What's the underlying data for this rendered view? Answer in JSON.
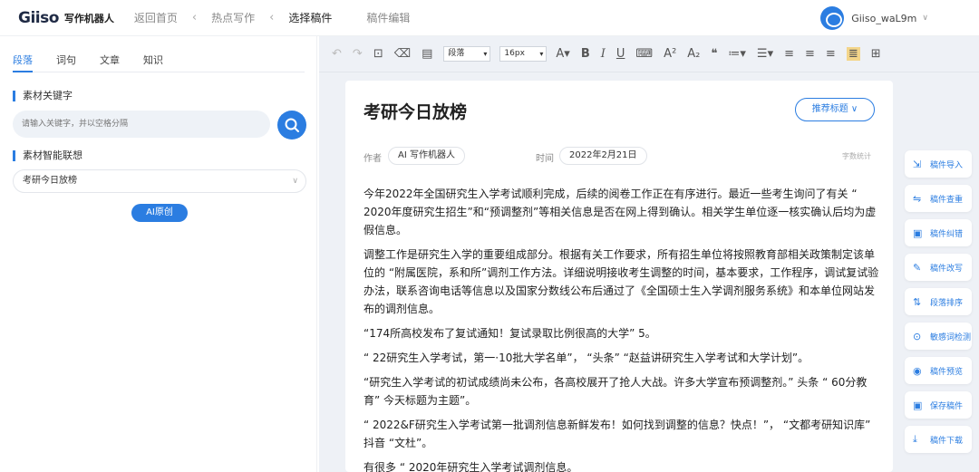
{
  "header": {
    "logo": "Giiso",
    "app_name": "写作机器人",
    "breadcrumbs": [
      "返回首页",
      "热点写作",
      "选择稿件"
    ],
    "extra": "稿件编辑",
    "user": "Giiso_waL9m"
  },
  "left": {
    "tabs": [
      "段落",
      "词句",
      "文章",
      "知识"
    ],
    "keyword_title": "素材关键字",
    "search_placeholder": "请输入关键字，并以空格分隔",
    "assoc_title": "素材智能联想",
    "assoc_value": "考研今日放榜",
    "ai_button": "AI原创"
  },
  "toolbar": {
    "paragraph_select": "段落",
    "font_size_select": "16px"
  },
  "doc": {
    "title": "考研今日放榜",
    "recommend_button": "推荐标题",
    "author_label": "作者",
    "author": "AI 写作机器人",
    "time_label": "时间",
    "date": "2022年2月21日",
    "wordcount": "字数统计",
    "paragraphs": [
      "今年2022年全国研究生入学考试顺利完成，后续的阅卷工作正在有序进行。最近一些考生询问了有关 “ 2020年度研究生招生”和“预调整剂”等相关信息是否在网上得到确认。相关学生单位逐一核实确认后均为虚假信息。",
      "调整工作是研究生入学的重要组成部分。根据有关工作要求，所有招生单位将按照教育部相关政策制定该单位的 “附属医院，系和所”调剂工作方法。详细说明接收考生调整的时间，基本要求，工作程序，调试复试验办法，联系咨询电话等信息以及国家分数线公布后通过了《全国硕士生入学调剂服务系统》和本单位网站发布的调剂信息。",
      "“174所高校发布了复试通知！复试录取比例很高的大学” 5。",
      "“ 22研究生入学考试，第一·10批大学名单”， “头条” “赵益讲研究生入学考试和大学计划”。",
      "“研究生入学考试的初试成绩尚未公布，各高校展开了抢人大战。许多大学宣布预调整剂。” 头条 “ 60分教育” 今天标题为主题”。",
      "“ 2022&F研究生入学考试第一批调剂信息新鲜发布！如何找到调整的信息？快点！”， “文都考研知识库” 抖音 “文杜”。",
      "有很多 “ 2020年研究生入学考试调剂信息。"
    ]
  },
  "actions": [
    "稿件导入",
    "稿件查重",
    "稿件纠错",
    "稿件改写",
    "段落排序",
    "敏感词检测",
    "稿件预览",
    "保存稿件",
    "稿件下载"
  ]
}
